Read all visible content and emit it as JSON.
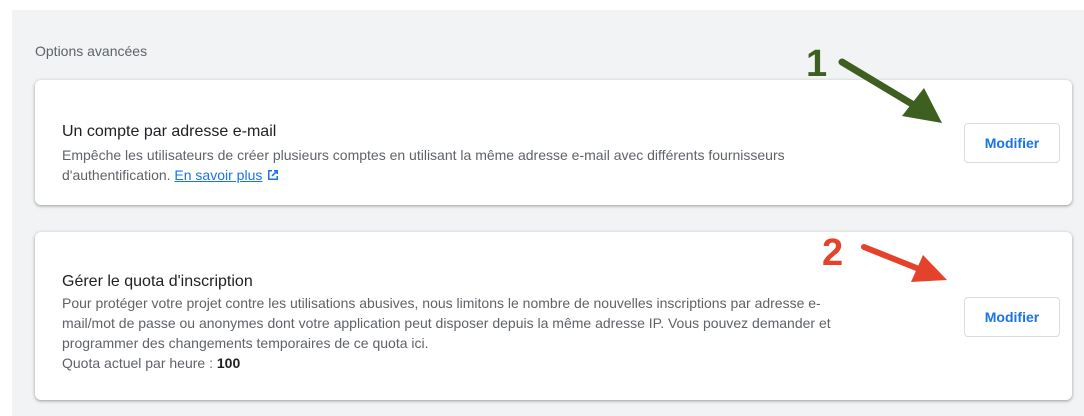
{
  "section": {
    "title": "Options avancées"
  },
  "cards": [
    {
      "title": "Un compte par adresse e-mail",
      "description_line1": "Empêche les utilisateurs de créer plusieurs comptes en utilisant la même adresse e-mail avec différents fournisseurs",
      "description_line2": "d'authentification.",
      "link_text": "En savoir plus",
      "button_label": "Modifier"
    },
    {
      "title": "Gérer le quota d'inscription",
      "description_line1": "Pour protéger votre projet contre les utilisations abusives, nous limitons le nombre de nouvelles inscriptions par adresse e-",
      "description_line2": "mail/mot de passe ou anonymes dont votre application peut disposer depuis la même adresse IP. Vous pouvez demander et",
      "description_line3": "programmer des changements temporaires de ce quota ici.",
      "quota_label": "Quota actuel par heure : ",
      "quota_value": "100",
      "button_label": "Modifier"
    }
  ],
  "annotations": [
    {
      "label": "1",
      "color": "#3d5f20"
    },
    {
      "label": "2",
      "color": "#e5422b"
    }
  ],
  "icons": {
    "external_link": "external-link-icon"
  }
}
